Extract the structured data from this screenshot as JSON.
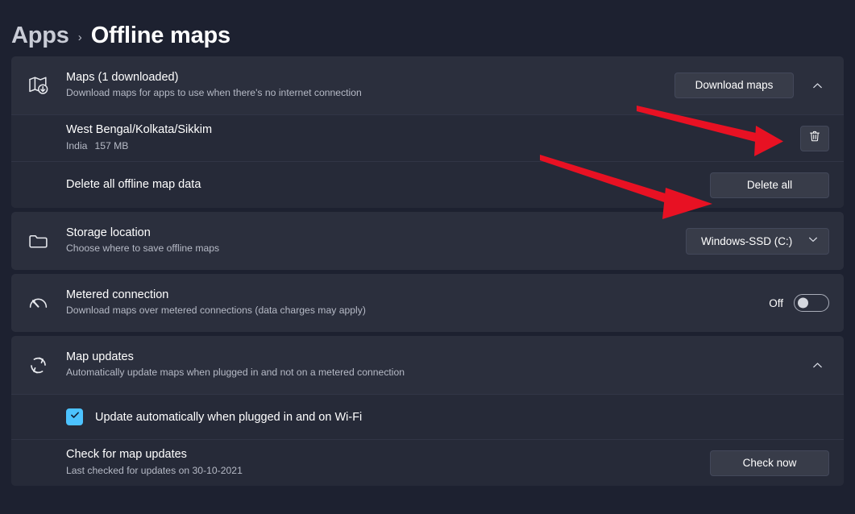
{
  "breadcrumb": {
    "parent": "Apps",
    "separator": "›",
    "current": "Offline maps"
  },
  "accent_color": "#4cc2ff",
  "annotation_color": "#e81123",
  "cards": {
    "maps": {
      "icon": "map-download-icon",
      "title": "Maps (1 downloaded)",
      "subtitle": "Download maps for apps to use when there's no internet connection",
      "download_button": "Download maps",
      "expand_state": "expanded",
      "expand_icon": "chevron-up-icon",
      "downloaded_map": {
        "title": "West Bengal/Kolkata/Sikkim",
        "country": "India",
        "size": "157 MB",
        "delete_icon": "trash-icon"
      },
      "delete_all": {
        "title": "Delete all offline map data",
        "button": "Delete all"
      }
    },
    "storage": {
      "icon": "folder-icon",
      "title": "Storage location",
      "subtitle": "Choose where to save offline maps",
      "selected_value": "Windows-SSD (C:)",
      "dropdown_icon": "chevron-down-icon"
    },
    "metered": {
      "icon": "gauge-icon",
      "title": "Metered connection",
      "subtitle": "Download maps over metered connections (data charges may apply)",
      "toggle_label": "Off",
      "toggle_state": "off"
    },
    "updates": {
      "icon": "refresh-icon",
      "title": "Map updates",
      "subtitle": "Automatically update maps when plugged in and not on a metered connection",
      "expand_state": "expanded",
      "expand_icon": "chevron-up-icon",
      "auto_update": {
        "label": "Update automatically when plugged in and on Wi-Fi",
        "checked": true
      },
      "check_updates": {
        "title": "Check for map updates",
        "subtitle": "Last checked for updates on 30-10-2021",
        "button": "Check now"
      }
    }
  }
}
